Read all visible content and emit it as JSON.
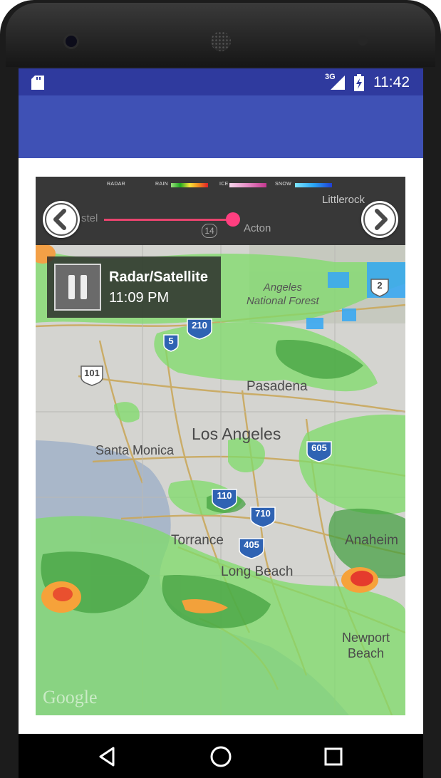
{
  "status_bar": {
    "network": "3G",
    "time": "11:42"
  },
  "legend": {
    "radar": "RADAR",
    "rain": "RAIN",
    "ice": "ICE",
    "snow": "SNOW"
  },
  "controls": {
    "prev_icon": "chevron-left-icon",
    "next_icon": "chevron-right-icon",
    "slider_progress": 0.88,
    "labels": {
      "left": "stel",
      "right_top": "Littlerock",
      "highway": "14",
      "acton": "Acton"
    }
  },
  "player": {
    "layer_title": "Radar/Satellite",
    "time": "11:09 PM",
    "button_icon": "pause-icon"
  },
  "map": {
    "places": {
      "angeles_forest": "Angeles\nNational Forest",
      "pasadena": "Pasadena",
      "los_angeles": "Los Angeles",
      "santa_monica": "Santa Monica",
      "torrance": "Torrance",
      "long_beach": "Long Beach",
      "anaheim": "Anaheim",
      "newport_beach": "Newport\nBeach"
    },
    "shields": {
      "i210": "210",
      "i5": "5",
      "us101": "101",
      "i605": "605",
      "i110": "110",
      "i710": "710",
      "i405": "405",
      "ca2": "2"
    },
    "attribution": "Google"
  },
  "nav_bar": {
    "back": "back-triangle-icon",
    "home": "home-circle-icon",
    "recents": "recents-square-icon"
  },
  "colors": {
    "status_bar": "#2f3a9e",
    "app_bar": "#3f51b5",
    "slider": "#ff3f80"
  }
}
